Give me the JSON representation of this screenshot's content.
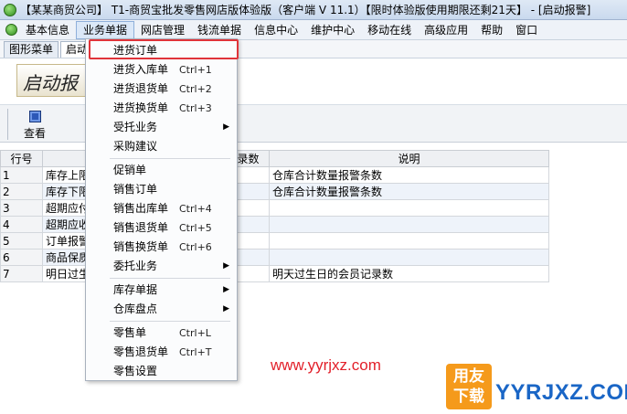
{
  "window": {
    "title": "【某某商贸公司】 T1-商贸宝批发零售网店版体验版（客户端 V 11.1）【限时体验版使用期限还剩21天】 - [启动报警]"
  },
  "menubar": {
    "items": [
      "基本信息",
      "业务单据",
      "网店管理",
      "钱流单据",
      "信息中心",
      "维护中心",
      "移动在线",
      "高级应用",
      "帮助",
      "窗口"
    ],
    "active_index": 1
  },
  "tabs": {
    "items": [
      "图形菜单",
      "启动"
    ]
  },
  "banner": {
    "text": "启动报"
  },
  "toolbar": {
    "view_label": "查看"
  },
  "table": {
    "headers": [
      "行号",
      "",
      "录数",
      "说明"
    ],
    "rows": [
      {
        "no": "1",
        "name": "库存上限",
        "note": "仓库合计数量报警条数"
      },
      {
        "no": "2",
        "name": "库存下限",
        "note": "仓库合计数量报警条数"
      },
      {
        "no": "3",
        "name": "超期应付",
        "note": ""
      },
      {
        "no": "4",
        "name": "超期应收",
        "note": ""
      },
      {
        "no": "5",
        "name": "订单报警",
        "note": ""
      },
      {
        "no": "6",
        "name": "商品保质",
        "note": ""
      },
      {
        "no": "7",
        "name": "明日过生",
        "note": "明天过生日的会员记录数"
      }
    ]
  },
  "dropdown": {
    "items": [
      {
        "label": "进货订单",
        "shortcut": "",
        "submenu": false
      },
      {
        "label": "进货入库单",
        "shortcut": "Ctrl+1",
        "submenu": false
      },
      {
        "label": "进货退货单",
        "shortcut": "Ctrl+2",
        "submenu": false
      },
      {
        "label": "进货换货单",
        "shortcut": "Ctrl+3",
        "submenu": false
      },
      {
        "label": "受托业务",
        "shortcut": "",
        "submenu": true
      },
      {
        "label": "采购建议",
        "shortcut": "",
        "submenu": false
      },
      {
        "label": "促销单",
        "shortcut": "",
        "submenu": false
      },
      {
        "label": "销售订单",
        "shortcut": "",
        "submenu": false
      },
      {
        "label": "销售出库单",
        "shortcut": "Ctrl+4",
        "submenu": false
      },
      {
        "label": "销售退货单",
        "shortcut": "Ctrl+5",
        "submenu": false
      },
      {
        "label": "销售换货单",
        "shortcut": "Ctrl+6",
        "submenu": false
      },
      {
        "label": "委托业务",
        "shortcut": "",
        "submenu": true
      },
      {
        "label": "库存单据",
        "shortcut": "",
        "submenu": true
      },
      {
        "label": "仓库盘点",
        "shortcut": "",
        "submenu": true
      },
      {
        "label": "零售单",
        "shortcut": "Ctrl+L",
        "submenu": false
      },
      {
        "label": "零售退货单",
        "shortcut": "Ctrl+T",
        "submenu": false
      },
      {
        "label": "零售设置",
        "shortcut": "",
        "submenu": false
      }
    ],
    "submenu_arrow": "▶"
  },
  "watermark": {
    "url": "www.yyrjxz.com",
    "logo_line1": "用友",
    "logo_line2": "下载",
    "logo_text": "YYRJXZ.COM"
  },
  "colors": {
    "highlight": "#e0343a",
    "watermark": "#e2202a",
    "logo": "#1a66c6"
  }
}
